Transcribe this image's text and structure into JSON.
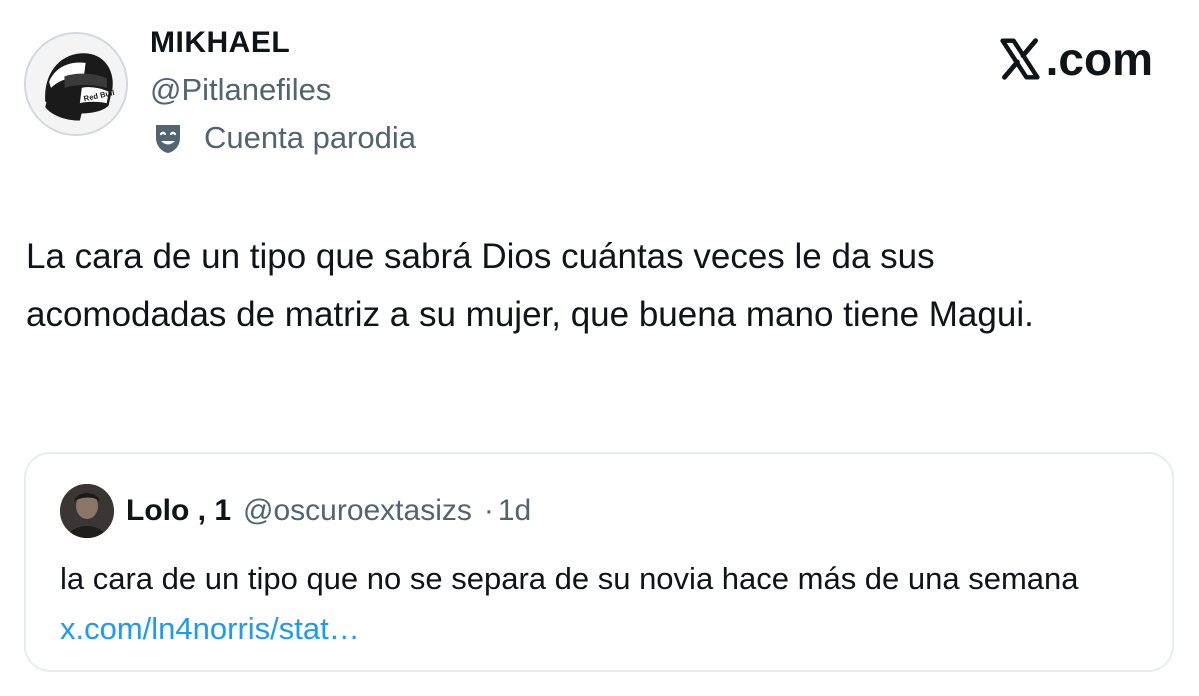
{
  "tweet": {
    "author_name": "MIKHAEL",
    "author_handle": "@Pitlanefiles",
    "parody_label": "Cuenta parodia",
    "parody_icon": "theater-masks-icon",
    "avatar_icon": "racing-helmet-icon",
    "avatar_helmet_text": "Red Bull",
    "text": "La cara de un tipo que sabrá Dios cuántas veces le da sus acomodadas de matriz a su mujer, que buena mano tiene Magui."
  },
  "brand": {
    "logo_icon": "x-logo-icon",
    "logo_text": ".com"
  },
  "quoted": {
    "name": "Lolo , 1",
    "handle": "@oscuroextasizs",
    "separator": "·",
    "time": "1d",
    "text": "la cara de un tipo que no se separa de su novia hace más de una semana ",
    "link": "x.com/ln4norris/stat…",
    "avatar_icon": "user-photo-avatar"
  },
  "colors": {
    "text": "#0f1419",
    "secondary": "#536471",
    "link": "#1d9bf0",
    "border": "#e7ecf0"
  }
}
